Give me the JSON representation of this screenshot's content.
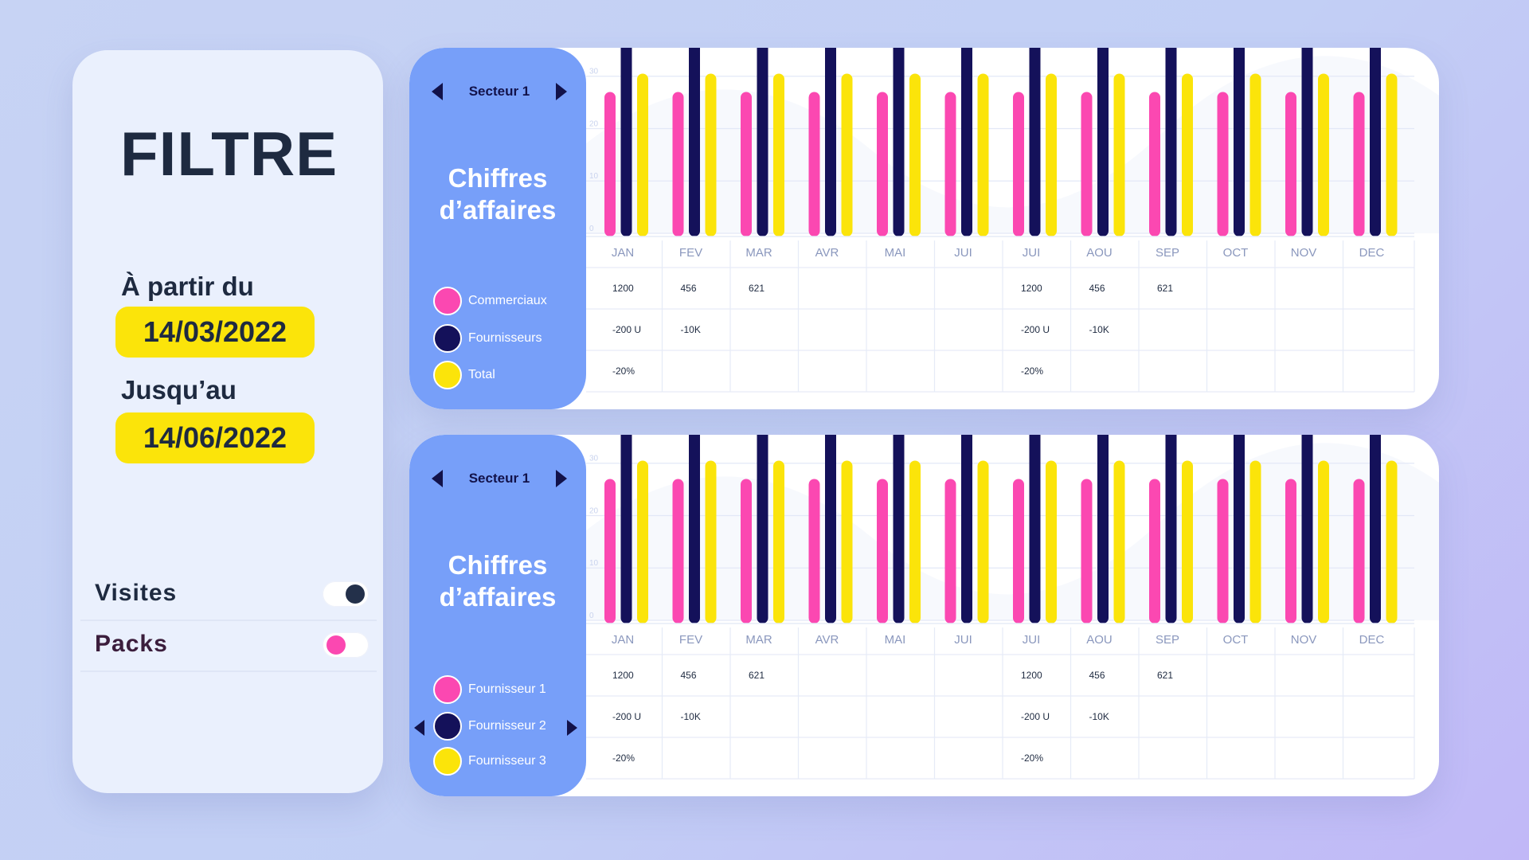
{
  "filter": {
    "title": "FILTRE",
    "from_label": "À partir du",
    "from_date": "14/03/2022",
    "to_label": "Jusqu’au",
    "to_date": "14/06/2022",
    "toggles": [
      {
        "label": "Visites",
        "on": true,
        "knob_color": "#23304a",
        "label_color": "#1e2a40"
      },
      {
        "label": "Packs",
        "on": false,
        "knob_color": "#fb48b1",
        "label_color": "#3b1d3c"
      }
    ]
  },
  "colors": {
    "pink": "#fb48b1",
    "navy": "#14115a",
    "yellow": "#fbe40a",
    "side_panel": "#779ff9",
    "accent_yellow": "#fbe40a"
  },
  "cards": [
    {
      "sector": "Secteur 1",
      "title_line1": "Chiffres",
      "title_line2": "d’affaires",
      "legend": [
        {
          "label": "Commerciaux",
          "color": "#fb48b1"
        },
        {
          "label": "Fournisseurs",
          "color": "#14115a"
        },
        {
          "label": "Total",
          "color": "#fbe40a"
        }
      ],
      "legend_has_arrows": false,
      "table": {
        "rows": [
          [
            "1200",
            "456",
            "621",
            "",
            "",
            "",
            "1200",
            "456",
            "621",
            "",
            "",
            ""
          ],
          [
            "-200 U",
            "-10K",
            "",
            "",
            "",
            "",
            "-200 U",
            "-10K",
            "",
            "",
            "",
            ""
          ],
          [
            "-20%",
            "",
            "",
            "",
            "",
            "",
            "-20%",
            "",
            "",
            "",
            "",
            ""
          ]
        ]
      }
    },
    {
      "sector": "Secteur 1",
      "title_line1": "Chiffres",
      "title_line2": "d’affaires",
      "legend": [
        {
          "label": "Fournisseur 1",
          "color": "#fb48b1"
        },
        {
          "label": "Fournisseur 2",
          "color": "#14115a"
        },
        {
          "label": "Fournisseur 3",
          "color": "#fbe40a"
        }
      ],
      "legend_has_arrows": true,
      "table": {
        "rows": [
          [
            "1200",
            "456",
            "621",
            "",
            "",
            "",
            "1200",
            "456",
            "621",
            "",
            "",
            ""
          ],
          [
            "-200 U",
            "-10K",
            "",
            "",
            "",
            "",
            "-200 U",
            "-10K",
            "",
            "",
            "",
            ""
          ],
          [
            "-20%",
            "",
            "",
            "",
            "",
            "",
            "-20%",
            "",
            "",
            "",
            "",
            ""
          ]
        ]
      }
    }
  ],
  "chart_data": [
    {
      "type": "bar",
      "categories": [
        "JAN",
        "FEV",
        "MAR",
        "AVR",
        "MAI",
        "JUI",
        "JUI",
        "AOU",
        "SEP",
        "OCT",
        "NOV",
        "DEC"
      ],
      "yticks": [
        "0",
        "10",
        "20",
        "30"
      ],
      "ylim": [
        0,
        33
      ],
      "grid": true,
      "series": [
        {
          "name": "Commerciaux",
          "color": "#fb48b1",
          "values": [
            27,
            27,
            27,
            27,
            27,
            27,
            27,
            27,
            27,
            27,
            27,
            27
          ]
        },
        {
          "name": "Fournisseurs",
          "color": "#14115a",
          "values": [
            38,
            38,
            38,
            38,
            38,
            38,
            38,
            38,
            38,
            38,
            38,
            38
          ]
        },
        {
          "name": "Total",
          "color": "#fbe40a",
          "values": [
            30.5,
            30.5,
            30.5,
            30.5,
            30.5,
            30.5,
            30.5,
            30.5,
            30.5,
            30.5,
            30.5,
            30.5
          ]
        }
      ]
    },
    {
      "type": "bar",
      "categories": [
        "JAN",
        "FEV",
        "MAR",
        "AVR",
        "MAI",
        "JUI",
        "JUI",
        "AOU",
        "SEP",
        "OCT",
        "NOV",
        "DEC"
      ],
      "yticks": [
        "0",
        "10",
        "20",
        "30"
      ],
      "ylim": [
        0,
        33
      ],
      "grid": true,
      "series": [
        {
          "name": "Fournisseur 1",
          "color": "#fb48b1",
          "values": [
            27,
            27,
            27,
            27,
            27,
            27,
            27,
            27,
            27,
            27,
            27,
            27
          ]
        },
        {
          "name": "Fournisseur 2",
          "color": "#14115a",
          "values": [
            38,
            38,
            38,
            38,
            38,
            38,
            38,
            38,
            38,
            38,
            38,
            38
          ]
        },
        {
          "name": "Fournisseur 3",
          "color": "#fbe40a",
          "values": [
            30.5,
            30.5,
            30.5,
            30.5,
            30.5,
            30.5,
            30.5,
            30.5,
            30.5,
            30.5,
            30.5,
            30.5
          ]
        }
      ]
    }
  ]
}
